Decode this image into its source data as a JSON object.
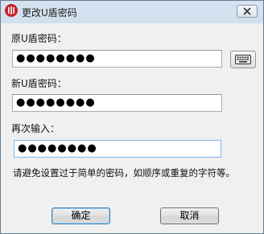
{
  "window": {
    "title": "更改U盾密码",
    "icons": {
      "app": "bank-logo-icon",
      "close": "close-icon"
    },
    "colors": {
      "app_icon": "#c8202a",
      "title_bar": "#d7e3f1",
      "body": "#f0f0f0"
    }
  },
  "form": {
    "old_password_label": "原U盾密码：",
    "old_password_value": "●●●●●●●●",
    "new_password_label": "新U盾密码：",
    "new_password_value": "●●●●●●●●",
    "confirm_label": "再次输入：",
    "confirm_value": "●●●●●●●●",
    "keyboard_icon": "keyboard-icon"
  },
  "hint": "请避免设置过于简单的密码，如顺序或重复的字符等。",
  "buttons": {
    "ok": "确定",
    "cancel": "取消"
  }
}
